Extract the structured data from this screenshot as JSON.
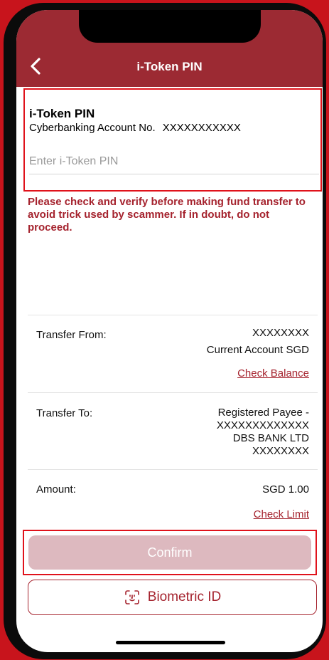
{
  "header": {
    "title": "i-Token PIN",
    "back_icon": "chevron-left-icon"
  },
  "pin": {
    "title": "i-Token PIN",
    "account_label": "Cyberbanking Account No.",
    "account_number": "XXXXXXXXXXX",
    "placeholder": "Enter i-Token PIN",
    "value": ""
  },
  "warning": "Please check and verify before making fund transfer to avoid trick used by scammer. If in doubt, do not proceed.",
  "transfer_from": {
    "label": "Transfer From:",
    "account": "XXXXXXXX",
    "account_type": "Current Account SGD",
    "link": "Check Balance"
  },
  "transfer_to": {
    "label": "Transfer To:",
    "payee_type": "Registered Payee -",
    "payee_account": "XXXXXXXXXXXXX",
    "bank": "DBS BANK LTD",
    "bank_account": "XXXXXXXX"
  },
  "amount": {
    "label": "Amount:",
    "value": "SGD 1.00",
    "link": "Check Limit"
  },
  "buttons": {
    "confirm": "Confirm",
    "biometric": "Biometric ID",
    "biometric_icon": "face-id-icon"
  },
  "colors": {
    "brand_red": "#9c2a33",
    "accent_text": "#a5232e",
    "confirm_disabled": "#ddb9bf",
    "highlight_border": "#e0121b"
  }
}
